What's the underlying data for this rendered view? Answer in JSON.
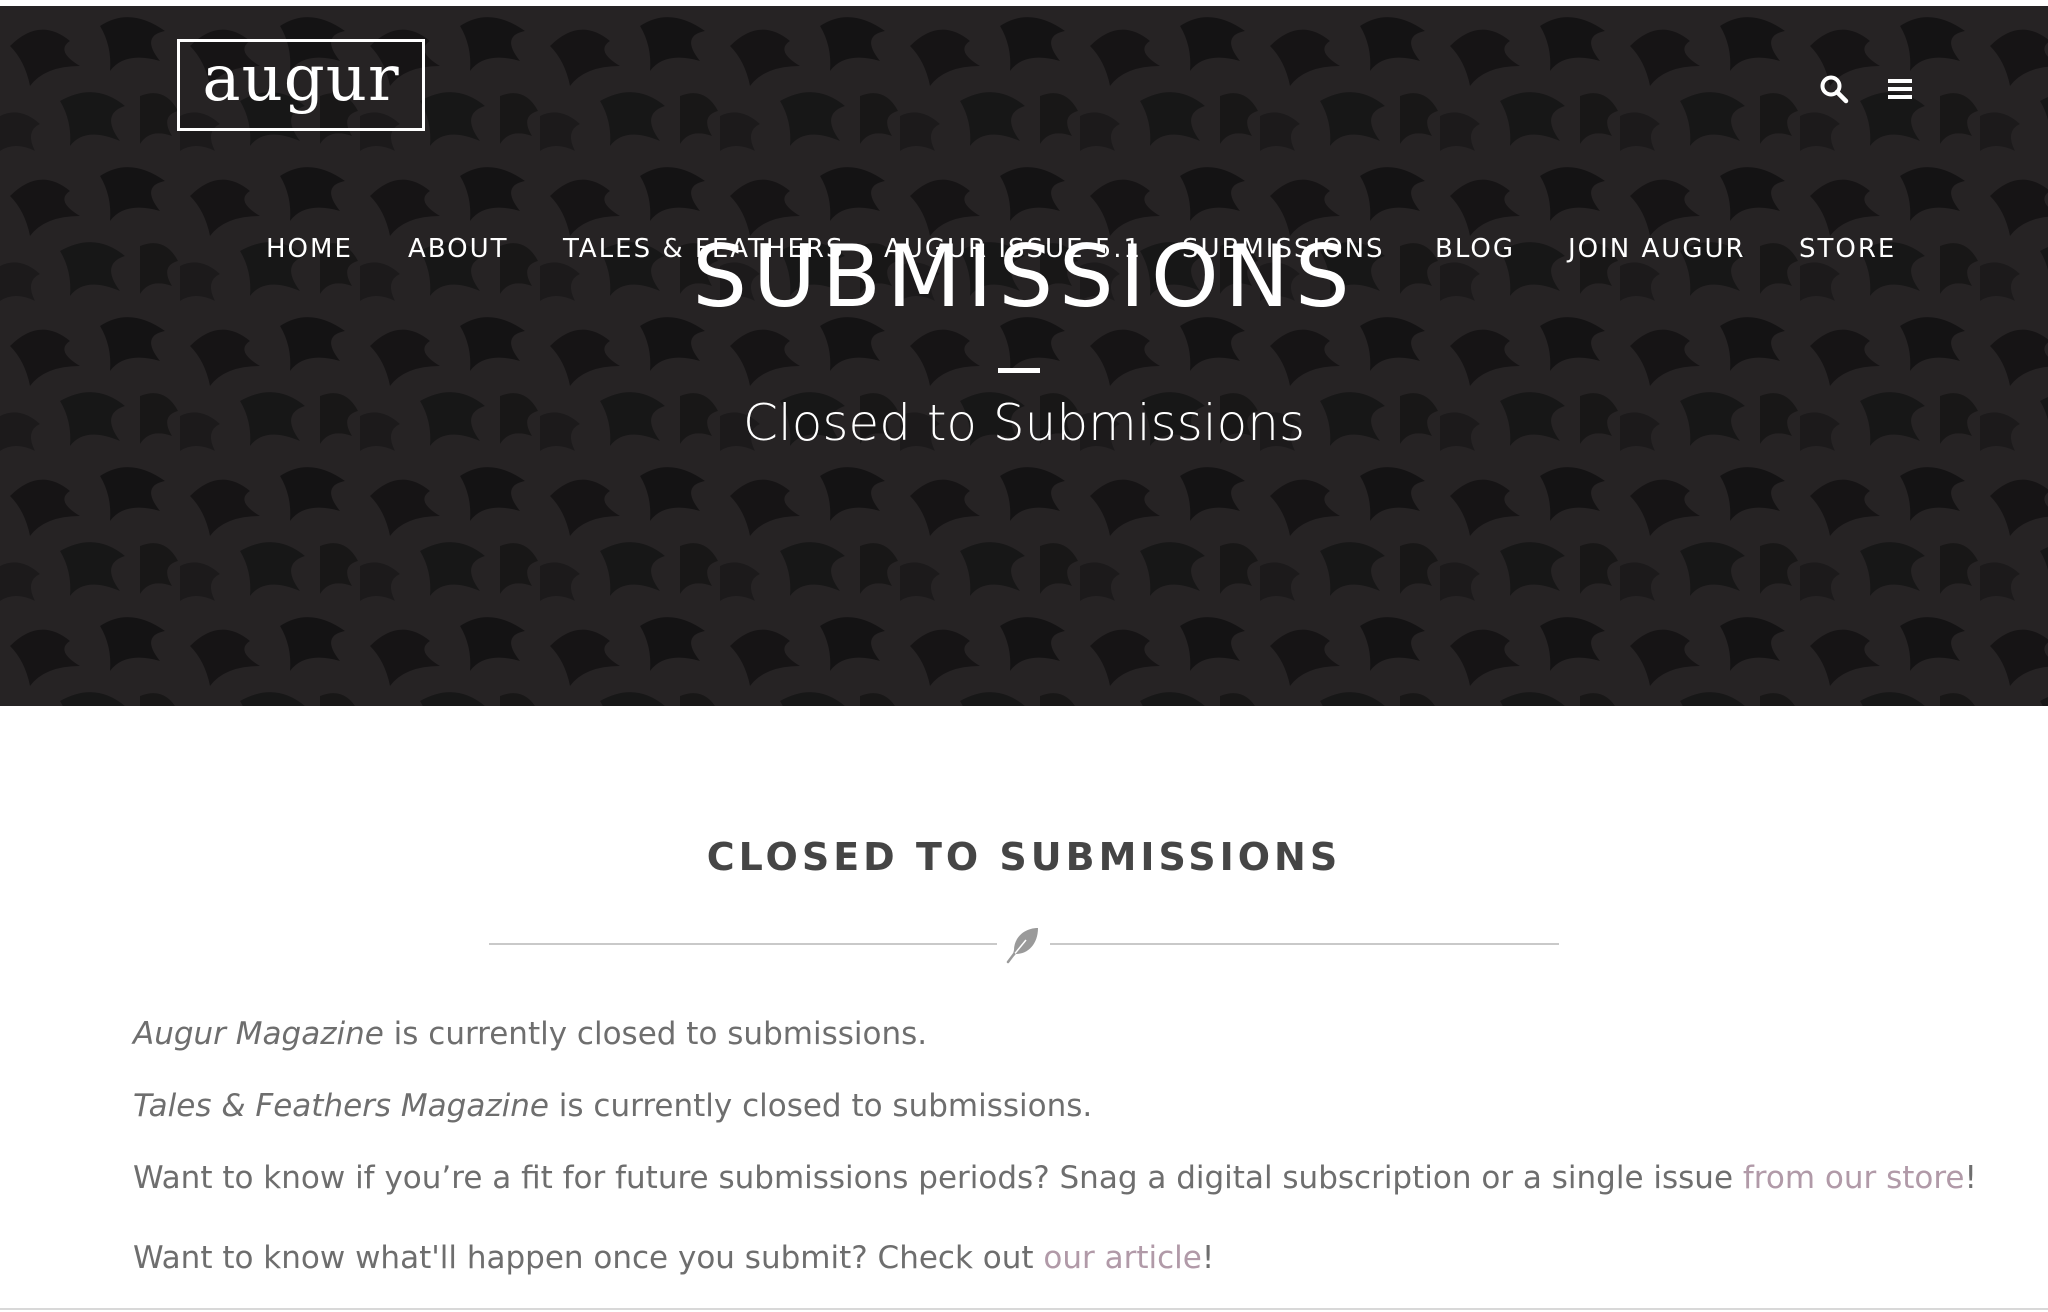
{
  "header": {
    "logo_text": "augur",
    "icons": [
      "search-icon",
      "hamburger-menu-icon"
    ]
  },
  "nav": {
    "items": [
      {
        "label": "HOME"
      },
      {
        "label": "ABOUT"
      },
      {
        "label": "TALES & FEATHERS"
      },
      {
        "label": "AUGUR ISSUE 5.1"
      },
      {
        "label": "SUBMISSIONS"
      },
      {
        "label": "BLOG"
      },
      {
        "label": "JOIN AUGUR"
      },
      {
        "label": "STORE"
      }
    ]
  },
  "hero": {
    "title": "SUBMISSIONS",
    "subtitle": "Closed to Submissions"
  },
  "content": {
    "section_title": "CLOSED TO SUBMISSIONS",
    "divider_icon": "feather-icon",
    "p1": {
      "em": "Augur Magazine",
      "text": " is currently closed to submissions."
    },
    "p2": {
      "em": "Tales & Feathers Magazine",
      "text": " is currently closed to submissions."
    },
    "p3": {
      "text": "Want to know if you’re a fit for future submissions periods? Snag a digital subscription or a single issue ",
      "link": "from our store",
      "tail": "!"
    },
    "p4": {
      "text": "Want to know what'll happen once you submit? Check out ",
      "link": "our article",
      "tail": "!"
    }
  },
  "colors": {
    "hero_bg": "#2a2728",
    "text": "#6e6e6e",
    "heading": "#454545",
    "link": "#b19aa8",
    "divider": "#c9c9c9"
  }
}
